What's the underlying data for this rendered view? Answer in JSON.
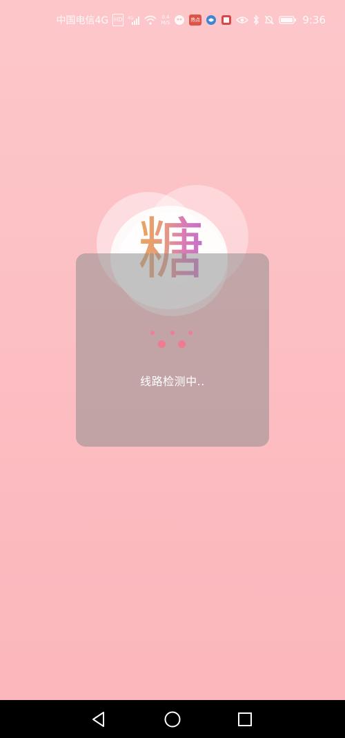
{
  "status_bar": {
    "carrier": "中国电信4G",
    "hd_badge": "HD",
    "signal_label": "4G",
    "net_speed_top": "0.4",
    "net_speed_bottom": "M/S",
    "app_badge_text": "热点",
    "battery": "",
    "time": "9:36",
    "icons": [
      "hd-icon",
      "signal-icon",
      "wifi-icon",
      "speed-icon",
      "app-icon-1",
      "app-icon-hot",
      "app-icon-browser",
      "app-icon-red",
      "eye-icon",
      "bluetooth-icon",
      "mute-icon",
      "battery-icon"
    ]
  },
  "logo": {
    "char": "糖"
  },
  "loading": {
    "text": "线路检测中.."
  },
  "nav_bar": {
    "buttons": [
      "back-icon",
      "home-icon",
      "recent-apps-icon"
    ]
  },
  "colors": {
    "background_top": "#fdc7ca",
    "background_bottom": "#fbb6bb",
    "dialog": "#8c8c8c",
    "dot": "#f07b91",
    "nav_bar": "#000000"
  }
}
